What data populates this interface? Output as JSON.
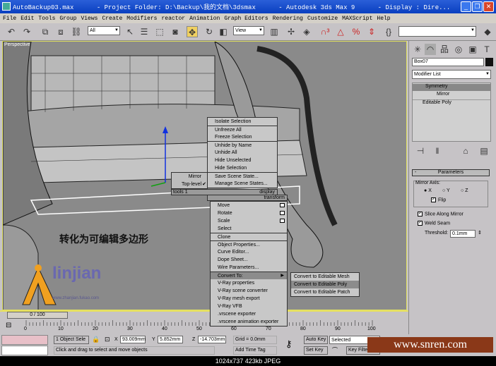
{
  "window": {
    "title": "AutoBackup03.max      - Project Folder: D:\\Backup\\我的文档\\3dsmax      - Autodesk 3ds Max 9      - Display : Dire...",
    "minimize": "_",
    "restore": "❐",
    "close": "✕"
  },
  "menubar": [
    "File",
    "Edit",
    "Tools",
    "Group",
    "Views",
    "Create",
    "Modifiers",
    "reactor",
    "Animation",
    "Graph Editors",
    "Rendering",
    "Customize",
    "MAXScript",
    "Help"
  ],
  "toolbar": {
    "selection_filter": "All",
    "ref_coord": "View",
    "named_selection": ""
  },
  "viewport": {
    "label": "Perspective",
    "caption": "转化为可编辑多边形",
    "logo_text": "linjian",
    "logo_sub": "www.zhanjian.fukao.com"
  },
  "quad_menu": {
    "left_items": [
      {
        "label": "Mirror"
      },
      {
        "label": "Top-level",
        "checked": true
      }
    ],
    "tools_header": "tools 1",
    "display_header": "display",
    "transform_header": "transform",
    "display_items": [
      [
        "Isolate Selection"
      ],
      [
        "Unfreeze All",
        "Freeze Selection"
      ],
      [
        "Unhide by Name",
        "Unhide All",
        "Hide Unselected",
        "Hide Selection"
      ],
      [
        "Save Scene State...",
        "Manage Scene States..."
      ]
    ],
    "transform_items": [
      [
        "Move",
        "Rotate",
        "Scale",
        "Select"
      ],
      [
        "Clone"
      ],
      [
        "Object Properties...",
        "Curve Editor...",
        "Dope Sheet...",
        "Wire Parameters..."
      ],
      [
        "Convert To:",
        "V-Ray properties",
        "V-Ray scene converter",
        "V-Ray mesh export",
        "V-Ray VFB",
        ".vrscene exporter",
        ".vrscene animation exporter"
      ]
    ],
    "submenu": [
      "Convert to Editable Mesh",
      "Convert to Editable Poly",
      "Convert to Editable Patch"
    ],
    "submenu_highlighted": "Convert to Editable Poly"
  },
  "command_panel": {
    "object_name": "Box07",
    "modifier_list": "Modifier List",
    "stack": [
      {
        "label": "Symmetry",
        "selected": true
      },
      {
        "label": "Mirror",
        "sub": true
      },
      {
        "label": "Editable Poly"
      }
    ],
    "rollout": "Parameters",
    "mirror_axis_label": "Mirror Axis:",
    "axes": [
      "X",
      "Y",
      "Z"
    ],
    "selected_axis": "X",
    "flip": "Flip",
    "slice": "Slice Along Mirror",
    "weld": "Weld Seam",
    "threshold_label": "Threshold:",
    "threshold": "0.1mm"
  },
  "timeline": {
    "frame": "0 / 100",
    "ticks": [
      "0",
      "10",
      "20",
      "30",
      "40",
      "50",
      "60",
      "70",
      "80",
      "90",
      "100"
    ]
  },
  "status": {
    "selection": "1 Object Sele",
    "x": "93.009mm",
    "y": "5.852mm",
    "z": "-14.703mm",
    "grid": "Grid = 0.0mm",
    "prompt": "Click and drag to select and move objects",
    "add_time_tag": "Add Time Tag",
    "auto_key": "Auto Key",
    "set_key": "Set Key",
    "key_mode": "Selected",
    "key_filters": "Key Filters...",
    "x_label": "X",
    "y_label": "Y",
    "z_label": "Z"
  },
  "watermark": "www.snren.com",
  "footer": "1024x737  423kb  JPEG"
}
